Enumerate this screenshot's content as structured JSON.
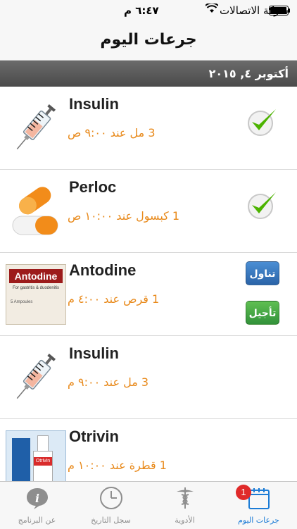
{
  "status_bar": {
    "carrier": "شركة الاتصالات",
    "time": "٦:٤٧ م"
  },
  "navbar": {
    "title": "جرعات اليوم"
  },
  "section": {
    "date": "أكتوبر ٤, ٢٠١٥"
  },
  "doses": [
    {
      "name": "Insulin",
      "dose": "3 مل عند ٩:٠٠ ص",
      "icon": "syringe-icon",
      "status": "taken"
    },
    {
      "name": "Perloc",
      "dose": "1 كبسول عند ١٠:٠٠ ص",
      "icon": "capsule-icon",
      "status": "taken"
    },
    {
      "name": "Antodine",
      "dose": "1 قرص عند ٤:٠٠ م",
      "icon": "antodine-box-image",
      "status": "pending",
      "box_text": "Antodine",
      "box_sub": "For gastritis & duodenitis",
      "box_amp": "5 Ampoules"
    },
    {
      "name": "Insulin",
      "dose": "3 مل عند ٩:٠٠ م",
      "icon": "syringe-icon",
      "status": "none"
    },
    {
      "name": "Otrivin",
      "dose": "1 قطرة عند ١٠:٠٠ م",
      "icon": "otrivin-bottle-image",
      "status": "none",
      "box_text": "Otrivin"
    }
  ],
  "actions": {
    "take_label": "تناول",
    "postpone_label": "تأجيل"
  },
  "tabbar": {
    "tabs": [
      {
        "label": "عن البرنامج",
        "icon": "info-icon"
      },
      {
        "label": "سجل التاريخ",
        "icon": "clock-icon"
      },
      {
        "label": "الأدوية",
        "icon": "caduceus-icon"
      },
      {
        "label": "جرعات اليوم",
        "icon": "calendar-icon",
        "badge": "1"
      }
    ]
  },
  "colors": {
    "accent": "#1c7cd6",
    "dose_text": "#e8891a",
    "take": "#2b64a8",
    "postpone": "#32923a",
    "check": "#4cb300"
  }
}
